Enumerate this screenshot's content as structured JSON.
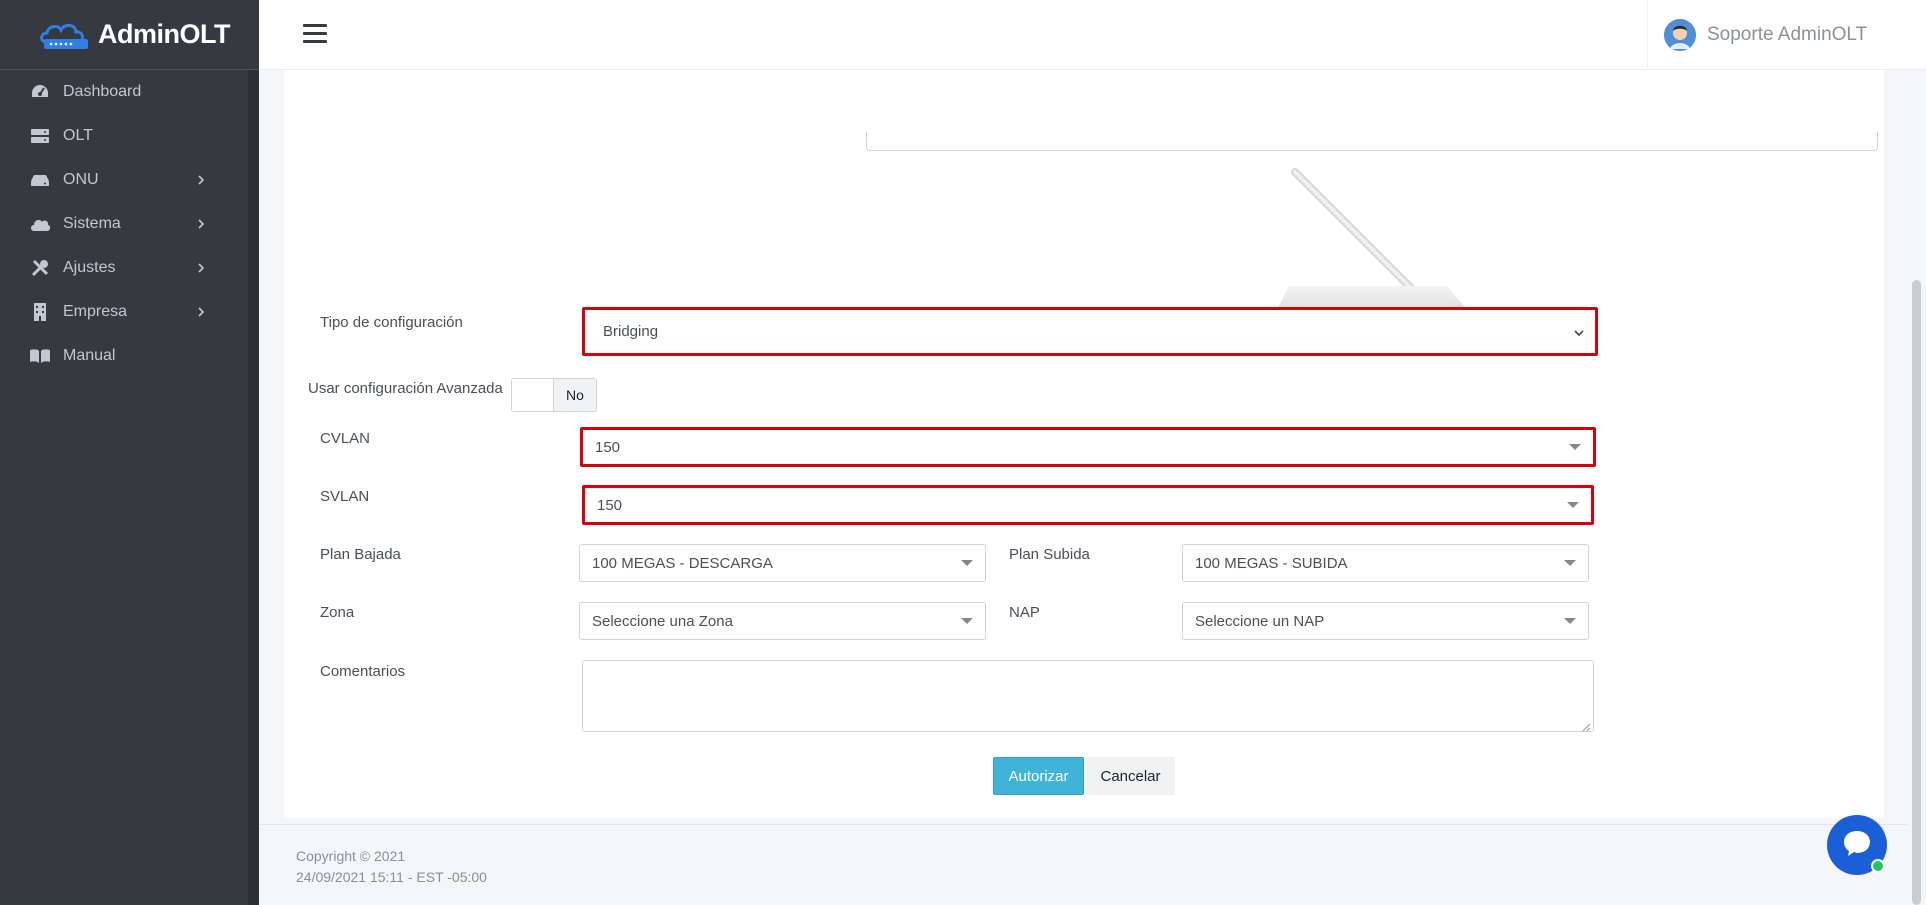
{
  "brand": {
    "name": "AdminOLT"
  },
  "sidebar": {
    "items": [
      {
        "label": "Dashboard",
        "icon": "tachometer-icon",
        "expandable": false
      },
      {
        "label": "OLT",
        "icon": "server-icon",
        "expandable": false
      },
      {
        "label": "ONU",
        "icon": "hdd-icon",
        "expandable": true
      },
      {
        "label": "Sistema",
        "icon": "cloud-icon",
        "expandable": true
      },
      {
        "label": "Ajustes",
        "icon": "tools-icon",
        "expandable": true
      },
      {
        "label": "Empresa",
        "icon": "building-icon",
        "expandable": true
      },
      {
        "label": "Manual",
        "icon": "book-icon",
        "expandable": false
      }
    ]
  },
  "header": {
    "user_name": "Soporte AdminOLT"
  },
  "form": {
    "tipo_config": {
      "label": "Tipo de configuración",
      "value": "Bridging"
    },
    "avanzada": {
      "label": "Usar configuración Avanzada",
      "toggle_label": "No"
    },
    "cvlan": {
      "label": "CVLAN",
      "value": "150"
    },
    "svlan": {
      "label": "SVLAN",
      "value": "150"
    },
    "plan_bajada": {
      "label": "Plan Bajada",
      "value": "100 MEGAS - DESCARGA"
    },
    "plan_subida": {
      "label": "Plan Subida",
      "value": "100 MEGAS - SUBIDA"
    },
    "zona": {
      "label": "Zona",
      "value": "Seleccione una Zona"
    },
    "nap": {
      "label": "NAP",
      "value": "Seleccione un NAP"
    },
    "comentarios": {
      "label": "Comentarios",
      "value": ""
    },
    "autorizar_label": "Autorizar",
    "cancelar_label": "Cancelar"
  },
  "footer": {
    "copyright": "Copyright © 2021",
    "timestamp": "24/09/2021 15:11 - EST -05:00"
  },
  "colors": {
    "sidebar_bg": "#343a40",
    "highlight_border": "#d8000c",
    "primary_button": "#3fb4d6",
    "chat_bubble": "#1a5fd6"
  }
}
